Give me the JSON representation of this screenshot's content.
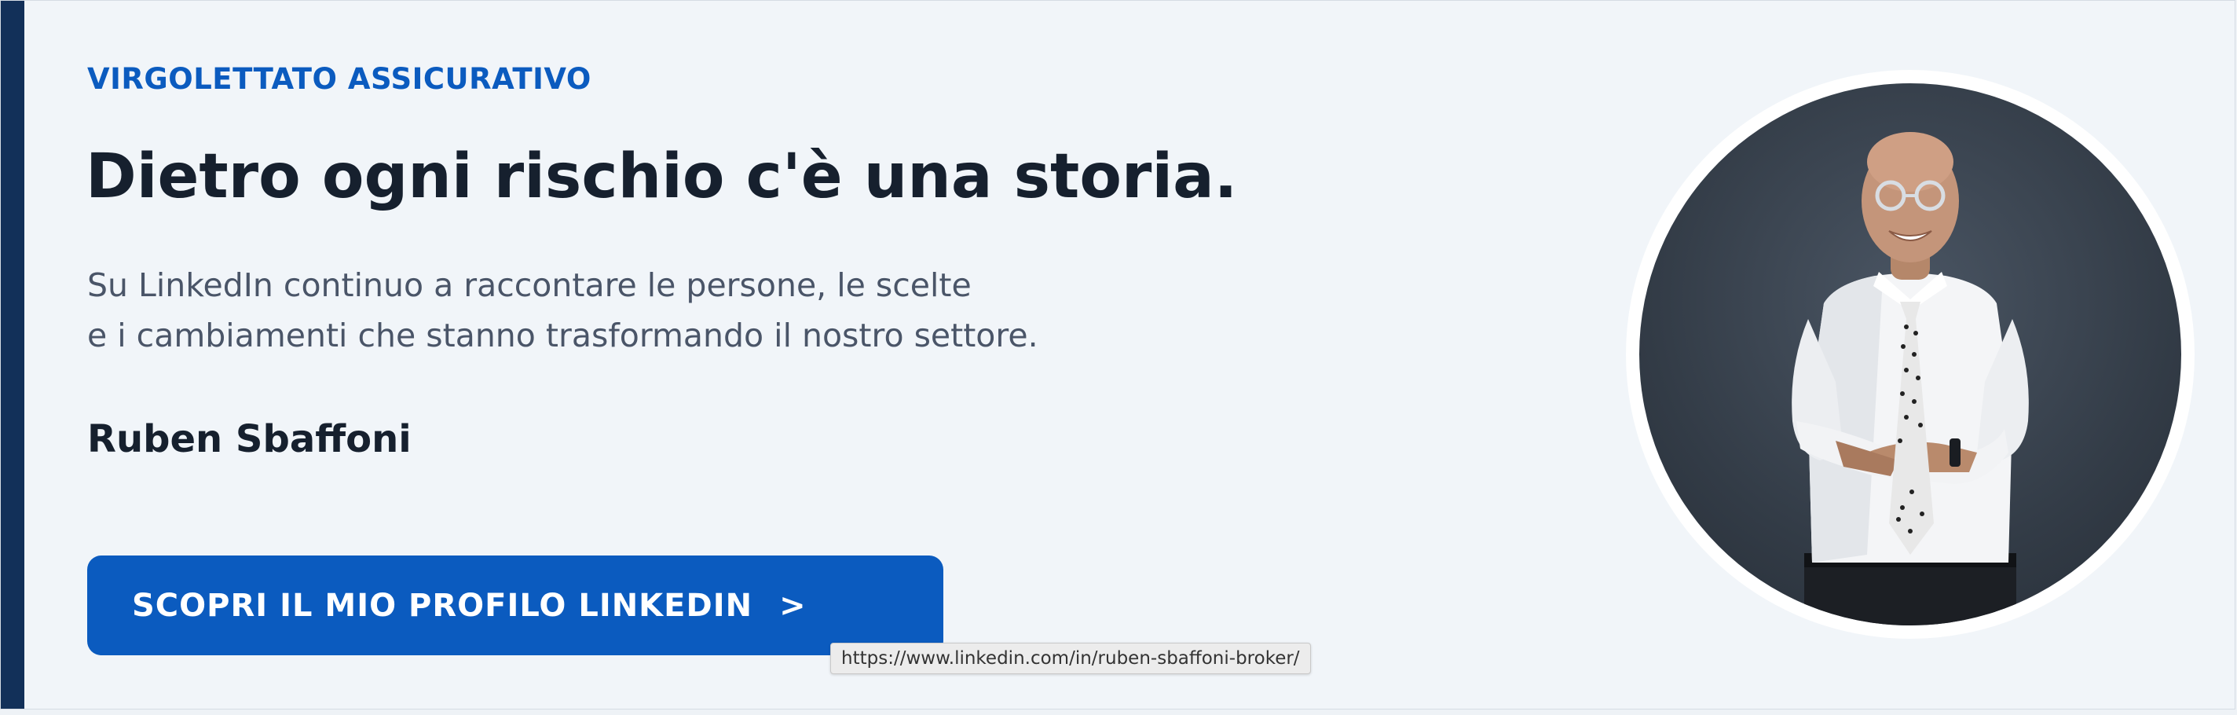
{
  "banner": {
    "eyebrow": "VIRGOLETTATO ASSICURATIVO",
    "headline": "Dietro ogni rischio c'è una storia.",
    "body_line_1": "Su LinkedIn continuo a raccontare le persone, le scelte",
    "body_line_2": "e i cambiamenti che stanno trasformando il nostro settore.",
    "author": "Ruben Sbaffoni",
    "cta_label": "SCOPRI IL MIO PROFILO LINKEDIN",
    "cta_arrow": ">",
    "tooltip_url": "https://www.linkedin.com/in/ruben-sbaffoni-broker/",
    "portrait_icon": "portrait-photo"
  },
  "colors": {
    "accent": "#0b5bbf",
    "left_bar": "#123059",
    "headline": "#16202e",
    "body": "#4a5568",
    "background": "#f1f5f9",
    "photo_bg": "#333c47"
  }
}
